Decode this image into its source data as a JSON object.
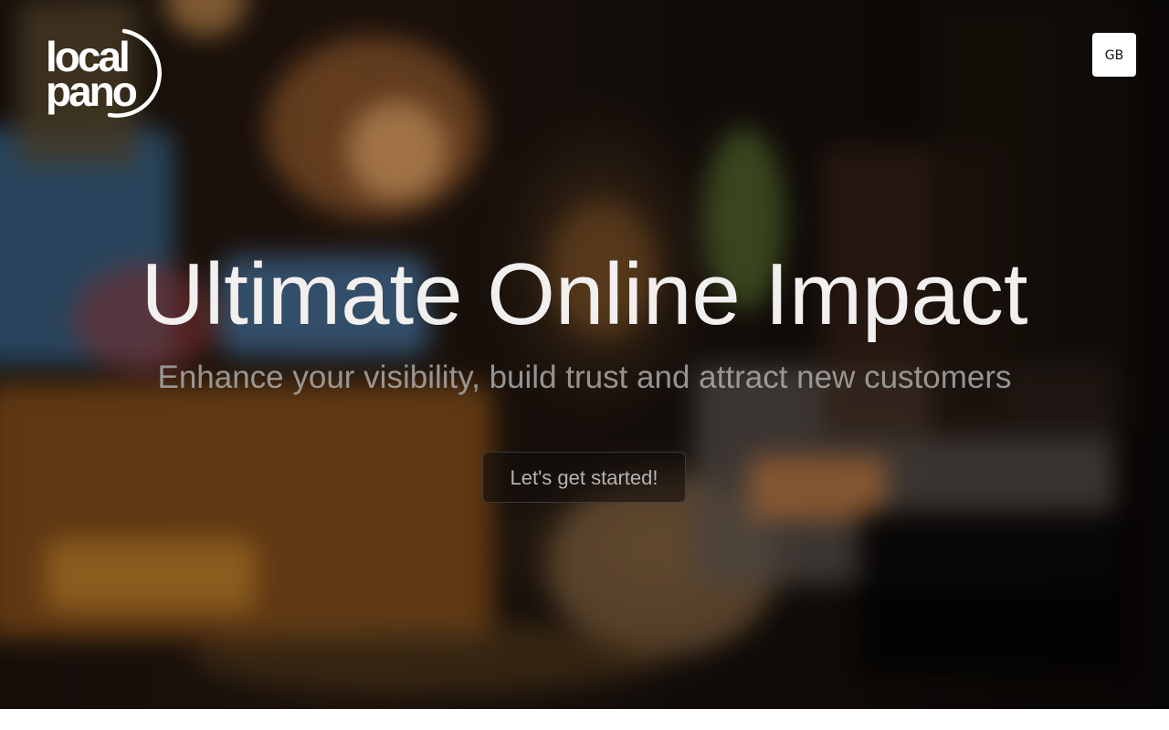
{
  "header": {
    "logo": {
      "line1": "local",
      "line2": "pano"
    },
    "language_button_label": "GB"
  },
  "hero": {
    "title": "Ultimate Online Impact",
    "subtitle": "Enhance your visibility, build trust and attract new customers",
    "cta_label": "Let's get started!"
  },
  "colors": {
    "title_text": "#f2f0ee",
    "subtitle_text": "#aaaaaa",
    "button_bg": "#ffffff"
  }
}
